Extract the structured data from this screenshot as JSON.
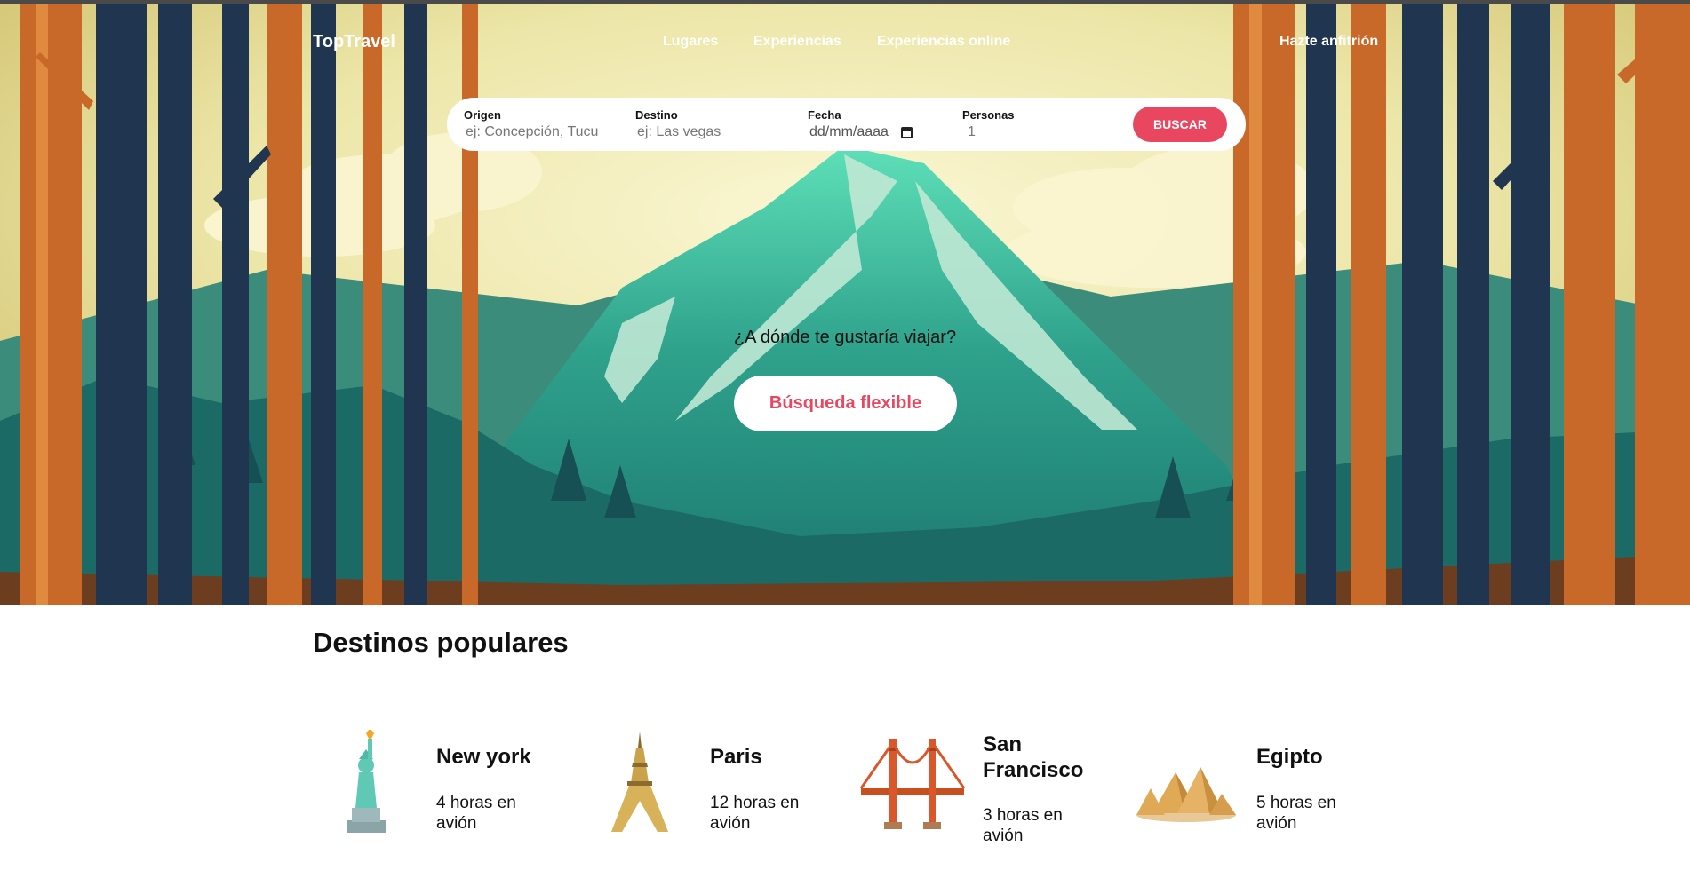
{
  "nav": {
    "brand": "TopTravel",
    "links": [
      "Lugares",
      "Experiencias",
      "Experiencias online"
    ],
    "host": "Hazte anfitrión"
  },
  "search": {
    "origen_label": "Origen",
    "origen_placeholder": "ej: Concepción, Tucu",
    "destino_label": "Destino",
    "destino_placeholder": "ej: Las vegas",
    "fecha_label": "Fecha",
    "fecha_value": "dd/mm/aaaa",
    "personas_label": "Personas",
    "personas_value": "1",
    "button": "BUSCAR"
  },
  "hero": {
    "question": "¿A dónde te gustaría viajar?",
    "flex_button": "Búsqueda flexible"
  },
  "popular": {
    "title": "Destinos populares",
    "destinations": [
      {
        "name": "New york",
        "duration": "4 horas en avión",
        "icon": "statue-of-liberty-icon"
      },
      {
        "name": "Paris",
        "duration": "12 horas en avión",
        "icon": "eiffel-tower-icon"
      },
      {
        "name": "San Francisco",
        "duration": "3 horas en avión",
        "icon": "golden-gate-bridge-icon"
      },
      {
        "name": "Egipto",
        "duration": "5 horas en avión",
        "icon": "pyramids-icon"
      }
    ]
  },
  "colors": {
    "accent": "#e8475f",
    "sky": "#e8e3a6",
    "mountain": "#2e9e8a",
    "trunk_orange": "#c8692a",
    "trunk_dark": "#1f3550"
  }
}
